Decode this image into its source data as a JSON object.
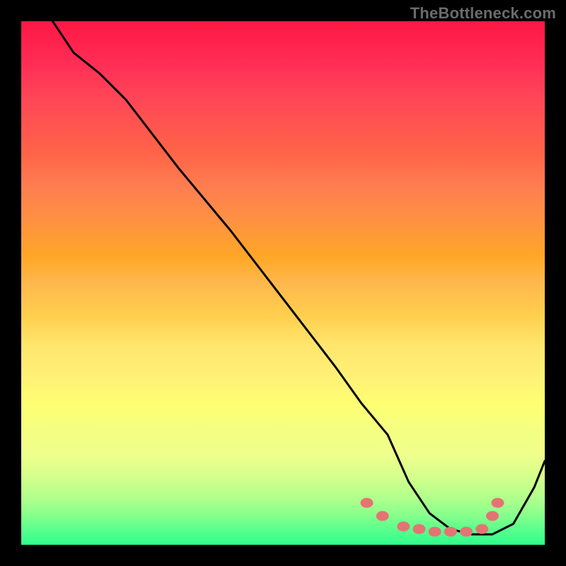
{
  "watermark": "TheBottleneck.com",
  "chart_data": {
    "type": "line",
    "title": "",
    "xlabel": "",
    "ylabel": "",
    "xlim": [
      0,
      100
    ],
    "ylim": [
      0,
      100
    ],
    "series": [
      {
        "name": "curve",
        "x": [
          6,
          8,
          10,
          15,
          20,
          30,
          40,
          50,
          60,
          65,
          70,
          74,
          78,
          82,
          86,
          90,
          94,
          98,
          100
        ],
        "y": [
          100,
          97,
          94,
          90,
          85,
          72,
          60,
          47,
          34,
          27,
          21,
          12,
          6,
          3,
          2,
          2,
          4,
          11,
          16
        ]
      }
    ],
    "markers": {
      "name": "highlight-points",
      "color": "#e57373",
      "x": [
        66,
        69,
        73,
        76,
        79,
        82,
        85,
        88,
        90,
        91
      ],
      "y": [
        8,
        5.5,
        3.5,
        3,
        2.5,
        2.5,
        2.5,
        3,
        5.5,
        8
      ]
    }
  }
}
